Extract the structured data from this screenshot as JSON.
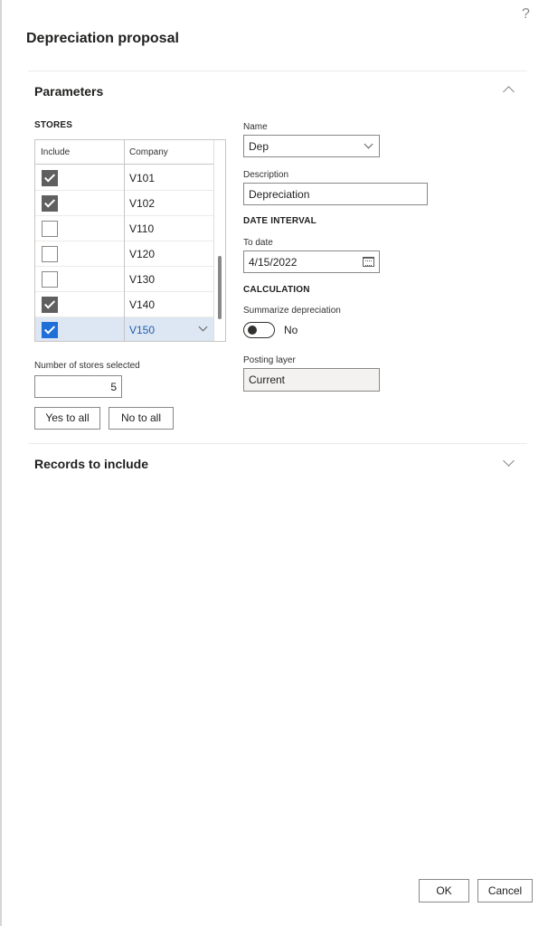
{
  "dialog": {
    "title": "Depreciation proposal",
    "help_icon": "?"
  },
  "parameters": {
    "section_title": "Parameters",
    "stores": {
      "heading": "STORES",
      "columns": [
        "Include",
        "Company"
      ],
      "rows": [
        {
          "included": true,
          "company": "V101"
        },
        {
          "included": true,
          "company": "V102"
        },
        {
          "included": false,
          "company": "V110"
        },
        {
          "included": false,
          "company": "V120"
        },
        {
          "included": false,
          "company": "V130"
        },
        {
          "included": true,
          "company": "V140"
        },
        {
          "included": true,
          "company": "V150",
          "selected": true
        }
      ]
    },
    "stores_selected": {
      "label": "Number of stores selected",
      "value": "5"
    },
    "yes_to_all_label": "Yes to all",
    "no_to_all_label": "No to all",
    "name": {
      "label": "Name",
      "value": "Dep"
    },
    "description": {
      "label": "Description",
      "value": "Depreciation"
    },
    "date_interval_heading": "DATE INTERVAL",
    "to_date": {
      "label": "To date",
      "value": "4/15/2022"
    },
    "calculation_heading": "CALCULATION",
    "summarize_depreciation": {
      "label": "Summarize depreciation",
      "value": "No"
    },
    "posting_layer": {
      "label": "Posting layer",
      "value": "Current"
    }
  },
  "records_to_include": {
    "section_title": "Records to include"
  },
  "footer": {
    "ok_label": "OK",
    "cancel_label": "Cancel"
  },
  "colors": {
    "accent": "#1f6fd8",
    "checked_gray": "#5f5f5f",
    "selected_row": "#dde6f3"
  }
}
